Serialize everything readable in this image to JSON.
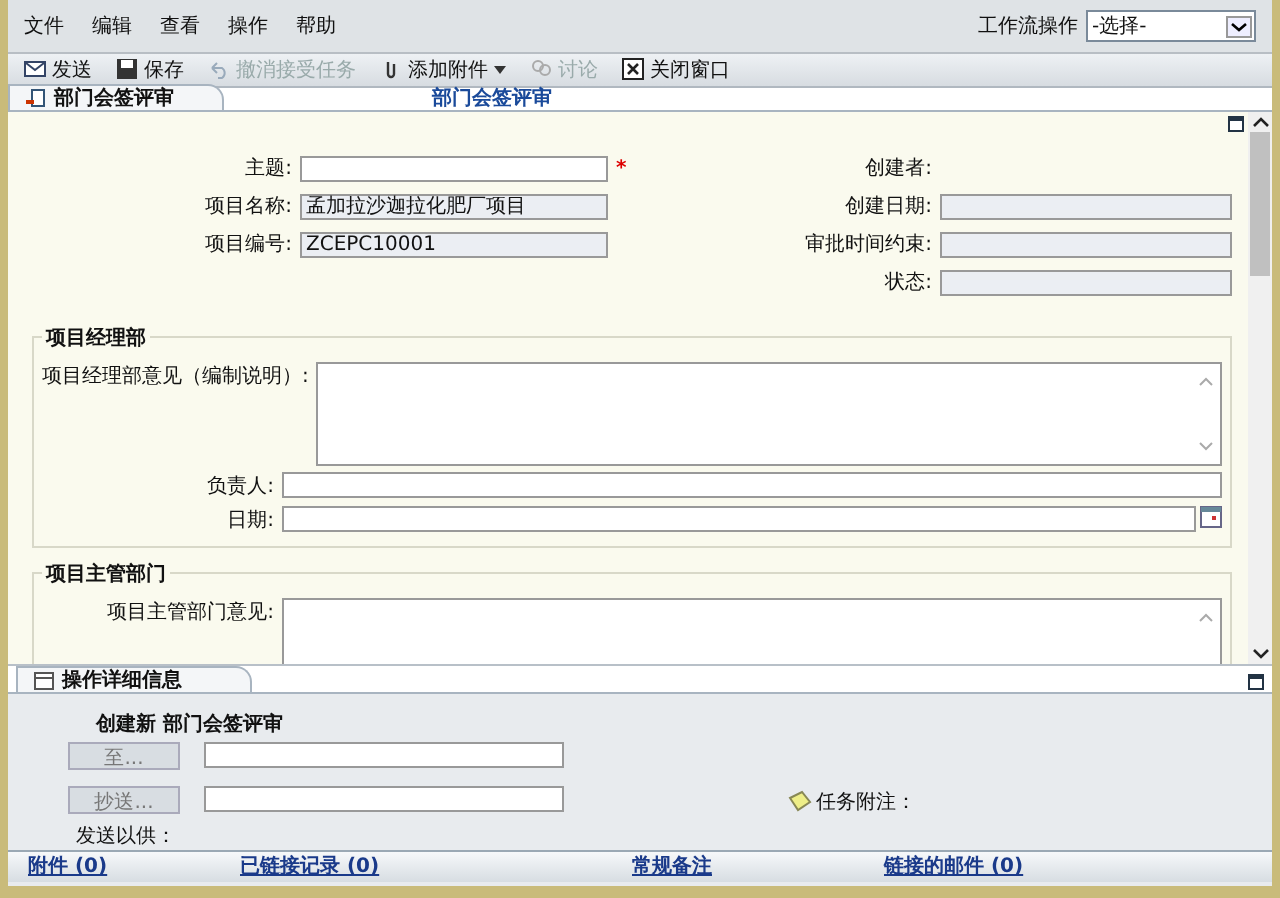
{
  "menu": [
    "文件",
    "编辑",
    "查看",
    "操作",
    "帮助"
  ],
  "workflow": {
    "label": "工作流操作",
    "value": "-选择-"
  },
  "toolbar": [
    {
      "kind": "send",
      "label": "发送",
      "disabled": false
    },
    {
      "kind": "save",
      "label": "保存",
      "disabled": false
    },
    {
      "kind": "undo",
      "label": "撤消接受任务",
      "disabled": true
    },
    {
      "kind": "attach",
      "label": "添加附件",
      "disabled": false
    },
    {
      "kind": "discuss",
      "label": "讨论",
      "disabled": true
    },
    {
      "kind": "close",
      "label": "关闭窗口",
      "disabled": false
    }
  ],
  "tab": {
    "label": "部门会签评审",
    "heading": "部门会签评审"
  },
  "form_left": [
    {
      "label": "主题:",
      "kind": "input",
      "marker": "*"
    },
    {
      "label": "项目名称:",
      "value": "孟加拉沙迦拉化肥厂项目",
      "kind": "readonly"
    },
    {
      "label": "项目编号:",
      "value": "ZCEPC10001",
      "kind": "readonly"
    }
  ],
  "form_right": [
    {
      "label": "创建者:",
      "kind": "text"
    },
    {
      "label": "创建日期:",
      "kind": "readonly"
    },
    {
      "label": "审批时间约束:",
      "kind": "readonly"
    },
    {
      "label": "状态:",
      "kind": "readonly"
    }
  ],
  "sections": [
    {
      "title": "项目经理部",
      "fields": [
        {
          "label": "项目经理部意见（编制说明）:",
          "kind": "textarea"
        },
        {
          "label": "负责人:",
          "kind": "input"
        },
        {
          "label": "日期:",
          "kind": "date"
        }
      ]
    },
    {
      "title": "项目主管部门",
      "fields": [
        {
          "label": "项目主管部门意见:",
          "kind": "textarea"
        }
      ]
    }
  ],
  "details": {
    "title": "操作详细信息",
    "heading": "创建新 部门会签评审",
    "to_button": "至...",
    "cc_button": "抄送...",
    "fyi": "发送以供：",
    "note_label": "任务附注："
  },
  "links": [
    "附件 (0)",
    "已链接记录 (0)",
    "常规备注",
    "链接的邮件 (0)"
  ]
}
